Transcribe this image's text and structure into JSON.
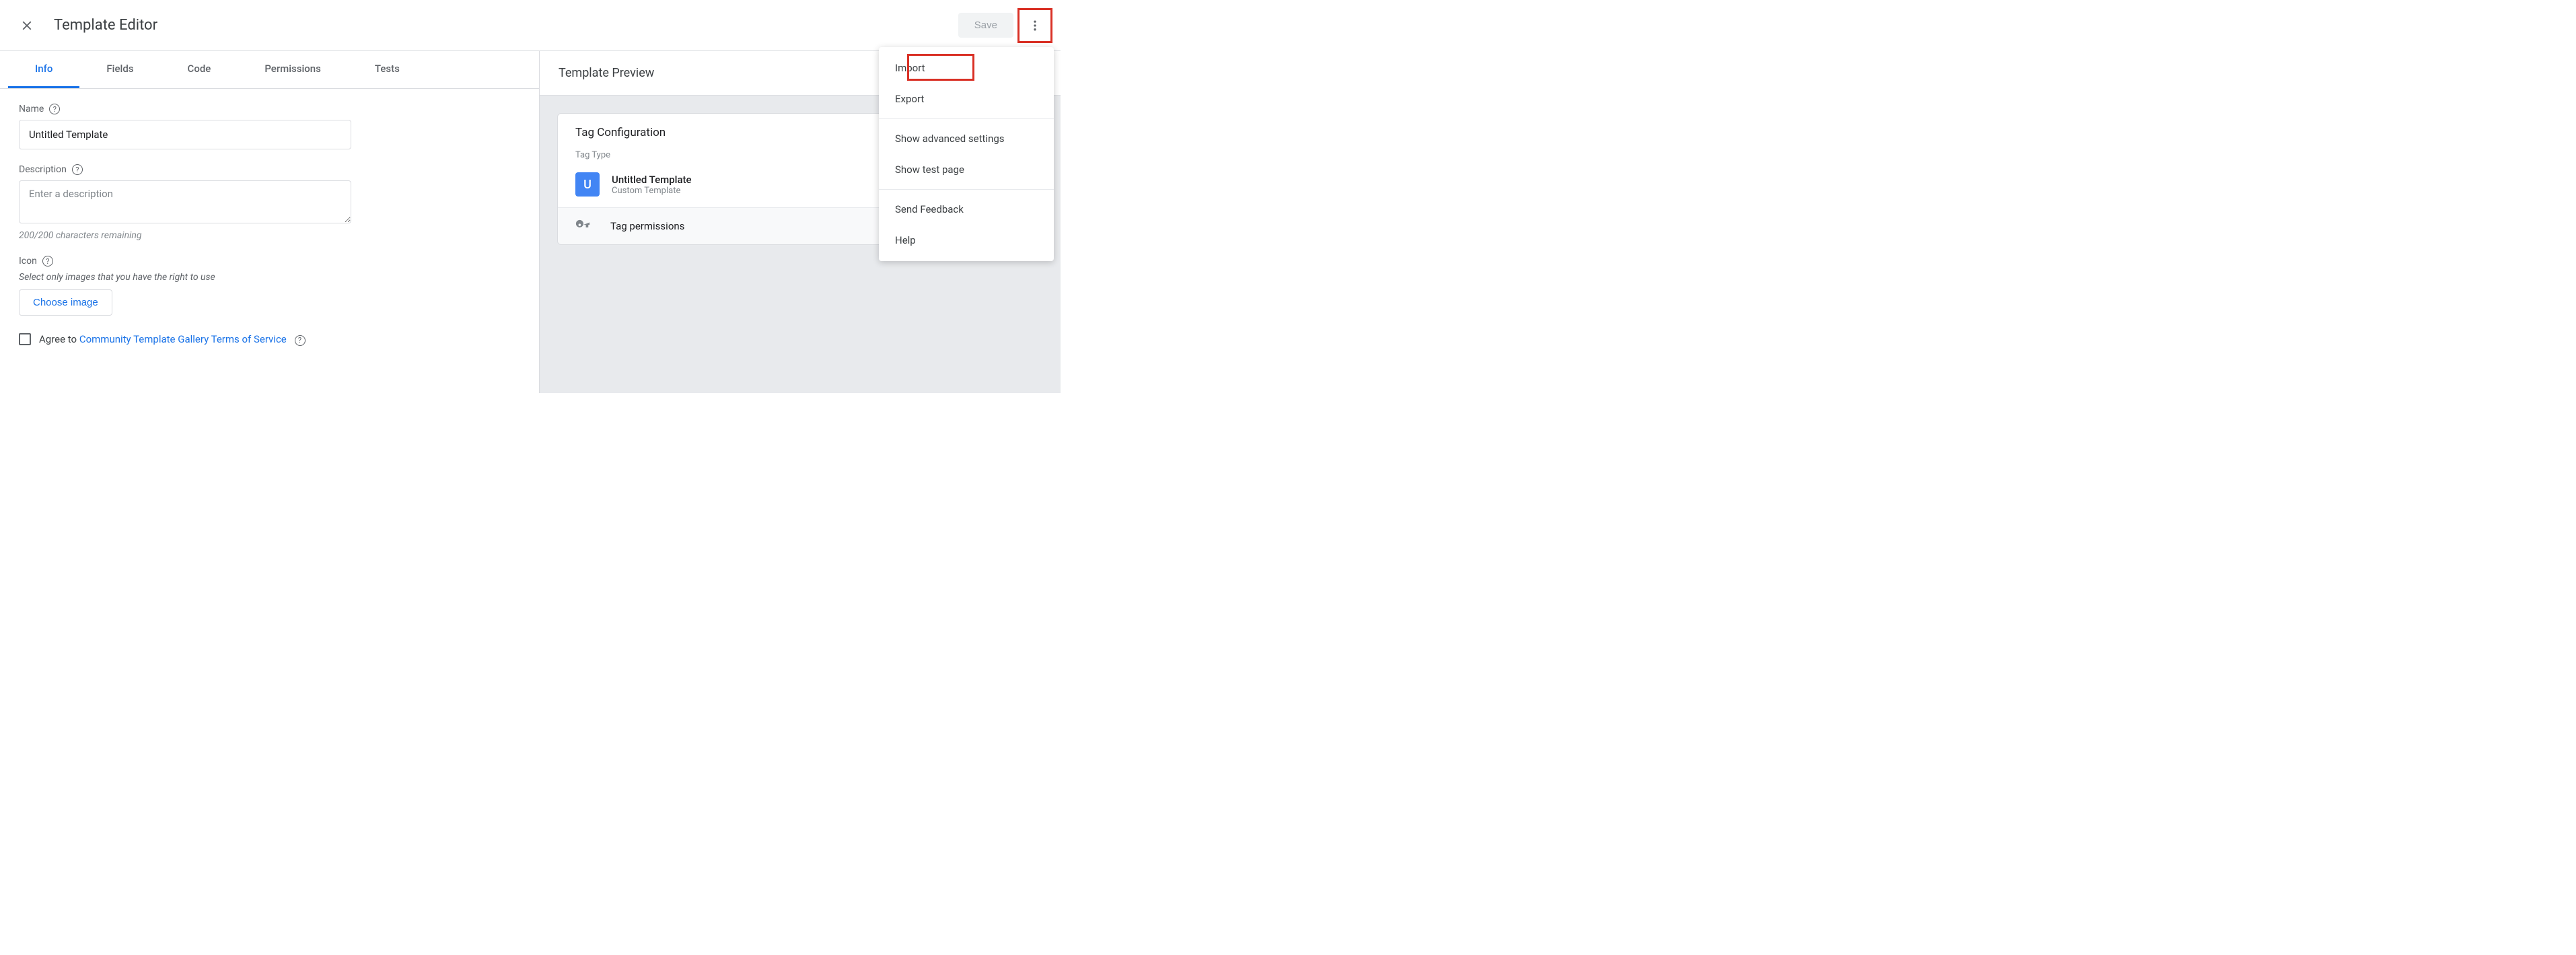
{
  "header": {
    "title": "Template Editor",
    "save_label": "Save"
  },
  "tabs": {
    "info": "Info",
    "fields": "Fields",
    "code": "Code",
    "permissions": "Permissions",
    "tests": "Tests"
  },
  "form": {
    "name_label": "Name",
    "name_value": "Untitled Template",
    "desc_label": "Description",
    "desc_placeholder": "Enter a description",
    "char_count": "200/200 characters remaining",
    "icon_label": "Icon",
    "icon_hint": "Select only images that you have the right to use",
    "choose_image": "Choose image",
    "agree_prefix": "Agree to ",
    "agree_link": "Community Template Gallery Terms of Service"
  },
  "preview": {
    "heading": "Template Preview",
    "card_title": "Tag Configuration",
    "tag_type_label": "Tag Type",
    "tag_badge": "U",
    "tag_name": "Untitled Template",
    "tag_sub": "Custom Template",
    "permissions": "Tag permissions"
  },
  "menu": {
    "import": "Import",
    "export": "Export",
    "advanced": "Show advanced settings",
    "test_page": "Show test page",
    "feedback": "Send Feedback",
    "help": "Help"
  }
}
